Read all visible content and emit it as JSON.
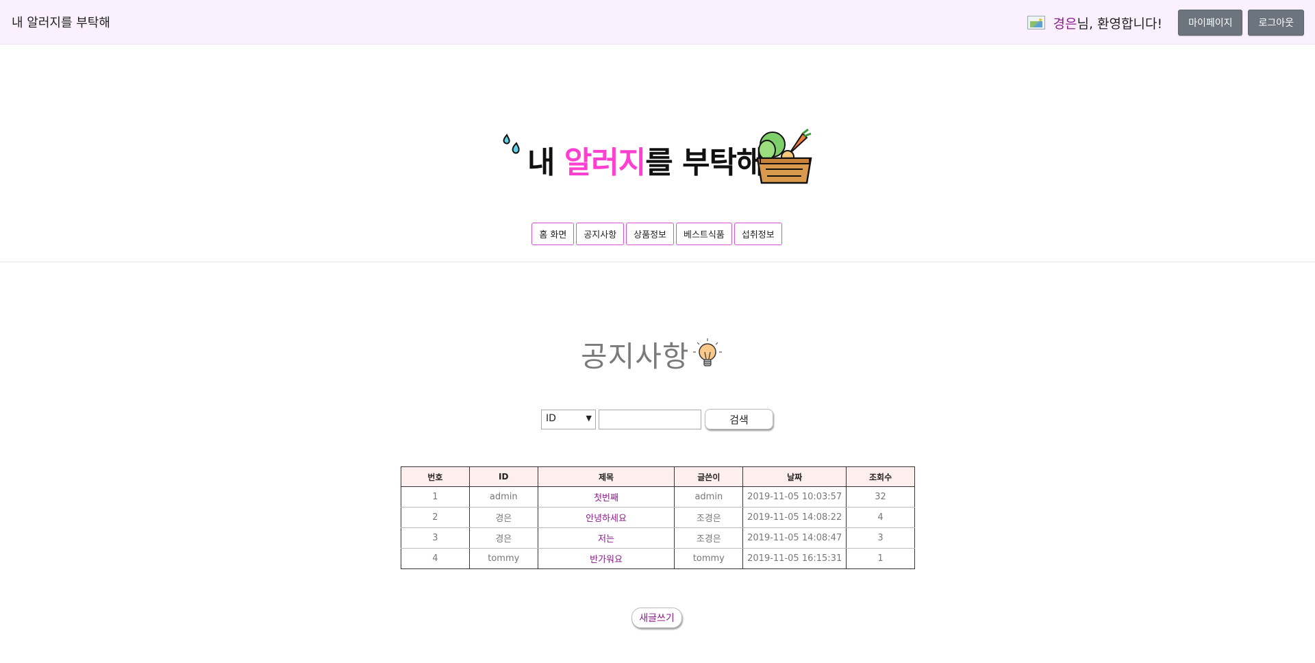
{
  "header": {
    "site_name": "내 알러지를 부탁해",
    "user_name": "경은",
    "greeting_suffix": "님, 환영합니다!",
    "mypage_label": "마이페이지",
    "logout_label": "로그아웃"
  },
  "logo": {
    "text_black_1": "내 ",
    "text_pink": "알러지",
    "text_black_2": "를 부탁해"
  },
  "nav": {
    "items": [
      "홈 화면",
      "공지사항",
      "상품정보",
      "베스트식품",
      "섭취정보"
    ]
  },
  "notice": {
    "title": "공지사항",
    "search_select_value": "ID",
    "search_input_value": "",
    "search_button_label": "검색",
    "write_button_label": "새글쓰기"
  },
  "table": {
    "headers": [
      "번호",
      "ID",
      "제목",
      "글쓴이",
      "날짜",
      "조회수"
    ],
    "rows": [
      [
        "1",
        "admin",
        "첫번째",
        "admin",
        "2019-11-05 10:03:57",
        "32"
      ],
      [
        "2",
        "경은",
        "안녕하세요",
        "조경은",
        "2019-11-05 14:08:22",
        "4"
      ],
      [
        "3",
        "경은",
        "저는",
        "조경은",
        "2019-11-05 14:08:47",
        "3"
      ],
      [
        "4",
        "tommy",
        "반가워요",
        "tommy",
        "2019-11-05 16:15:31",
        "1"
      ]
    ]
  },
  "colors": {
    "topbar_bg": "#fbf0fd",
    "accent_pink": "#ff3fd0",
    "nav_border": "#d653d6",
    "title_link": "#8b1a8b",
    "table_header_bg": "#feeeee",
    "dark_button": "#6c757d"
  },
  "icons": {
    "profile": "profile-image-icon",
    "drops": "water-drops-icon",
    "basket": "vegetable-basket-icon",
    "bulb": "light-bulb-icon"
  }
}
